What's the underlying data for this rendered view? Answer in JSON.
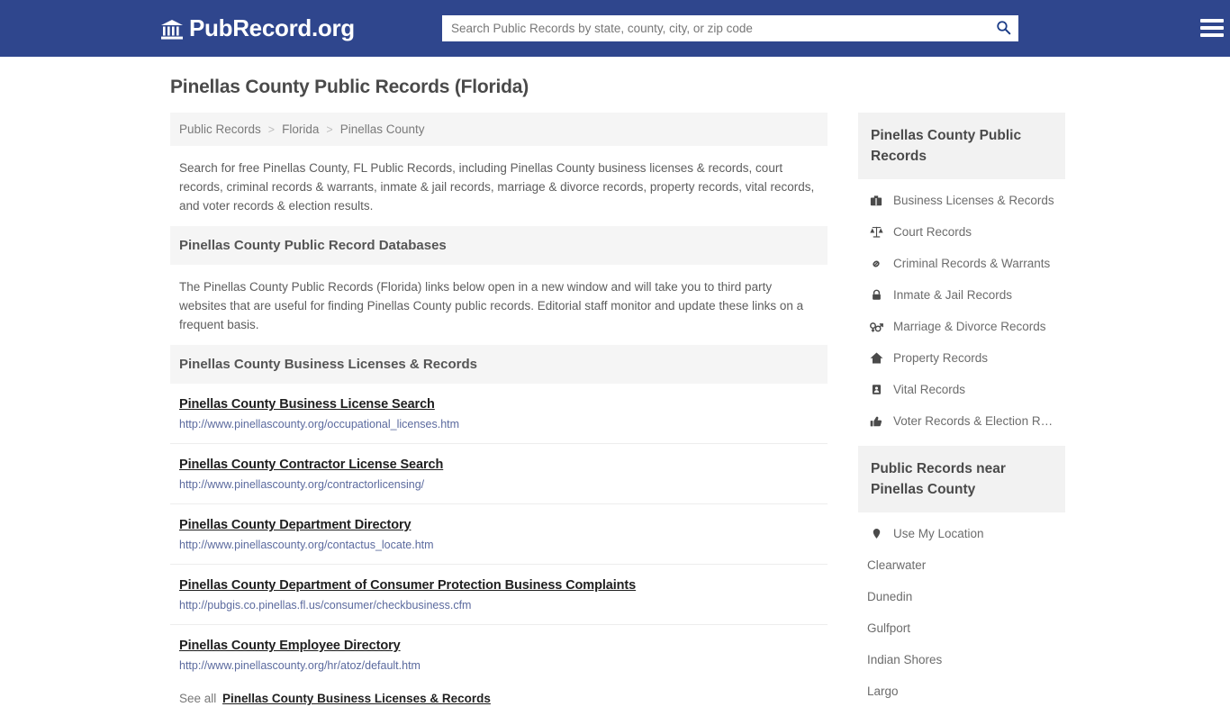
{
  "header": {
    "brand": "PubRecord.org",
    "brand_icon": "bank-icon",
    "search": {
      "placeholder": "Search Public Records by state, county, city, or zip code",
      "value": "",
      "button_icon": "search-icon"
    },
    "menu_icon": "hamburger-menu-icon",
    "background_color": "#2f468d"
  },
  "main": {
    "page_title": "Pinellas County Public Records (Florida)",
    "breadcrumb": {
      "items": [
        "Public Records",
        "Florida",
        "Pinellas County"
      ],
      "separator": ">"
    },
    "intro_text": "Search for free Pinellas County, FL Public Records, including Pinellas County business licenses & records, court records, criminal records & warrants, inmate & jail records, marriage & divorce records, property records, vital records, and voter records & election results.",
    "databases_section": {
      "heading": "Pinellas County Public Record Databases",
      "body": "The Pinellas County Public Records (Florida) links below open in a new window and will take you to third party websites that are useful for finding Pinellas County public records. Editorial staff monitor and update these links on a frequent basis."
    },
    "business_section": {
      "heading": "Pinellas County Business Licenses & Records",
      "links": [
        {
          "title": "Pinellas County Business License Search",
          "url": "http://www.pinellascounty.org/occupational_licenses.htm"
        },
        {
          "title": "Pinellas County Contractor License Search",
          "url": "http://www.pinellascounty.org/contractorlicensing/"
        },
        {
          "title": "Pinellas County Department Directory",
          "url": "http://www.pinellascounty.org/contactus_locate.htm"
        },
        {
          "title": "Pinellas County Department of Consumer Protection Business Complaints",
          "url": "http://pubgis.co.pinellas.fl.us/consumer/checkbusiness.cfm"
        },
        {
          "title": "Pinellas County Employee Directory",
          "url": "http://www.pinellascounty.org/hr/atoz/default.htm"
        }
      ],
      "see_all_prefix": "See all",
      "see_all_link": "Pinellas County Business Licenses & Records"
    }
  },
  "sidebar": {
    "records_box": {
      "heading": "Pinellas County Public Records",
      "items": [
        {
          "label": "Business Licenses & Records",
          "icon": "briefcase-icon"
        },
        {
          "label": "Court Records",
          "icon": "scales-of-justice-icon"
        },
        {
          "label": "Criminal Records & Warrants",
          "icon": "chain-link-icon"
        },
        {
          "label": "Inmate & Jail Records",
          "icon": "lock-icon"
        },
        {
          "label": "Marriage & Divorce Records",
          "icon": "venus-mars-icon"
        },
        {
          "label": "Property Records",
          "icon": "home-icon"
        },
        {
          "label": "Vital Records",
          "icon": "id-card-icon"
        },
        {
          "label": "Voter Records & Election R…",
          "icon": "thumbs-up-icon"
        }
      ]
    },
    "near_box": {
      "heading": "Public Records near Pinellas County",
      "use_my_location": {
        "label": "Use My Location",
        "icon": "map-pin-icon"
      },
      "cities": [
        "Clearwater",
        "Dunedin",
        "Gulfport",
        "Indian Shores",
        "Largo"
      ]
    }
  }
}
